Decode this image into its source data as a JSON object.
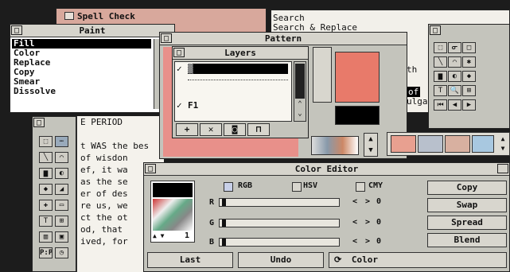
{
  "spell": {
    "title": "Spell Check"
  },
  "search": {
    "items": [
      "Search",
      "Search & Replace"
    ],
    "peek": [
      "th",
      "of",
      "ulga"
    ]
  },
  "paint": {
    "title": "Paint",
    "items": [
      "Fill",
      "Color",
      "Replace",
      "Copy",
      "Smear",
      "Dissolve"
    ],
    "selected_index": 0
  },
  "pattern": {
    "title": "Pattern"
  },
  "layers": {
    "title": "Layers",
    "rows": [
      {
        "check": "✓",
        "name": "▒"
      },
      {
        "check": "✓",
        "name": "F1"
      }
    ],
    "add_icon": "+",
    "delete_icon": "✕",
    "camera_icon": "camera",
    "lock_icon": "lock"
  },
  "doc": {
    "lines": [
      "E PERIOD",
      "",
      "t WAS the bes",
      "of wisdon",
      "ef, it wa",
      "as the se",
      "er of des",
      "re us, we",
      "ct the ot",
      "od, that",
      "ived, for"
    ]
  },
  "color_editor": {
    "title": "Color Editor",
    "modes": [
      {
        "label": "RGB",
        "active": true
      },
      {
        "label": "HSV",
        "active": false
      },
      {
        "label": "CMY",
        "active": false
      }
    ],
    "channels": [
      {
        "name": "R",
        "value": "0",
        "level": 0.02
      },
      {
        "name": "G",
        "value": "0",
        "level": 0.02
      },
      {
        "name": "B",
        "value": "0",
        "level": 0.02
      }
    ],
    "step_left": "<",
    "step_right": ">",
    "buttons": [
      "Copy",
      "Swap",
      "Spread",
      "Blend"
    ],
    "bottom": {
      "last": "Last",
      "undo": "Undo",
      "color": "Color"
    },
    "palette_index": "1"
  },
  "colors": {
    "pink": "#e8908a",
    "salmon": "#d8a090",
    "panel": "#c4c4bc",
    "black": "#000000"
  }
}
